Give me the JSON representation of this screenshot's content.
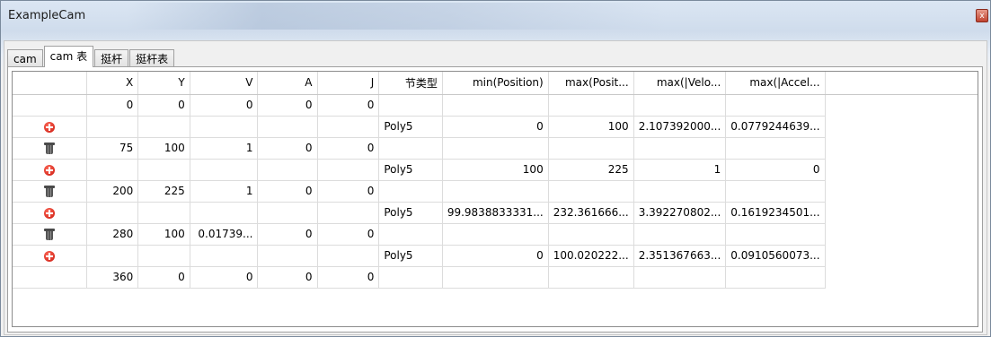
{
  "window": {
    "title": "ExampleCam",
    "close_glyph": "x"
  },
  "tabs": [
    {
      "label": "cam",
      "active": false
    },
    {
      "label": "cam 表",
      "active": true
    },
    {
      "label": "挺杆",
      "active": false
    },
    {
      "label": "挺杆表",
      "active": false
    }
  ],
  "columns": [
    "",
    "X",
    "Y",
    "V",
    "A",
    "J",
    "节类型",
    "min(Position)",
    "max(Posit...",
    "max(|Velo...",
    "max(|Accel..."
  ],
  "rows": [
    {
      "icon": "",
      "cells": [
        "0",
        "0",
        "0",
        "0",
        "0",
        "",
        "",
        "",
        "",
        ""
      ]
    },
    {
      "icon": "add-icon",
      "cells": [
        "",
        "",
        "",
        "",
        "",
        "Poly5",
        "0",
        "100",
        "2.107392000...",
        "0.0779244639..."
      ]
    },
    {
      "icon": "trash-icon",
      "cells": [
        "75",
        "100",
        "1",
        "0",
        "0",
        "",
        "",
        "",
        "",
        ""
      ]
    },
    {
      "icon": "add-icon",
      "cells": [
        "",
        "",
        "",
        "",
        "",
        "Poly5",
        "100",
        "225",
        "1",
        "0"
      ]
    },
    {
      "icon": "trash-icon",
      "cells": [
        "200",
        "225",
        "1",
        "0",
        "0",
        "",
        "",
        "",
        "",
        ""
      ]
    },
    {
      "icon": "add-icon",
      "cells": [
        "",
        "",
        "",
        "",
        "",
        "Poly5",
        "99.9838833331...",
        "232.361666...",
        "3.392270802...",
        "0.1619234501..."
      ]
    },
    {
      "icon": "trash-icon",
      "cells": [
        "280",
        "100",
        "0.01739...",
        "0",
        "0",
        "",
        "",
        "",
        "",
        ""
      ]
    },
    {
      "icon": "add-icon",
      "cells": [
        "",
        "",
        "",
        "",
        "",
        "Poly5",
        "0",
        "100.020222...",
        "2.351367663...",
        "0.0910560073..."
      ]
    },
    {
      "icon": "",
      "cells": [
        "360",
        "0",
        "0",
        "0",
        "0",
        "",
        "",
        "",
        "",
        ""
      ]
    }
  ],
  "colors": {
    "add": "#d0150a",
    "trash": "#4a4a4a",
    "grid_line": "#dcdcdc"
  }
}
